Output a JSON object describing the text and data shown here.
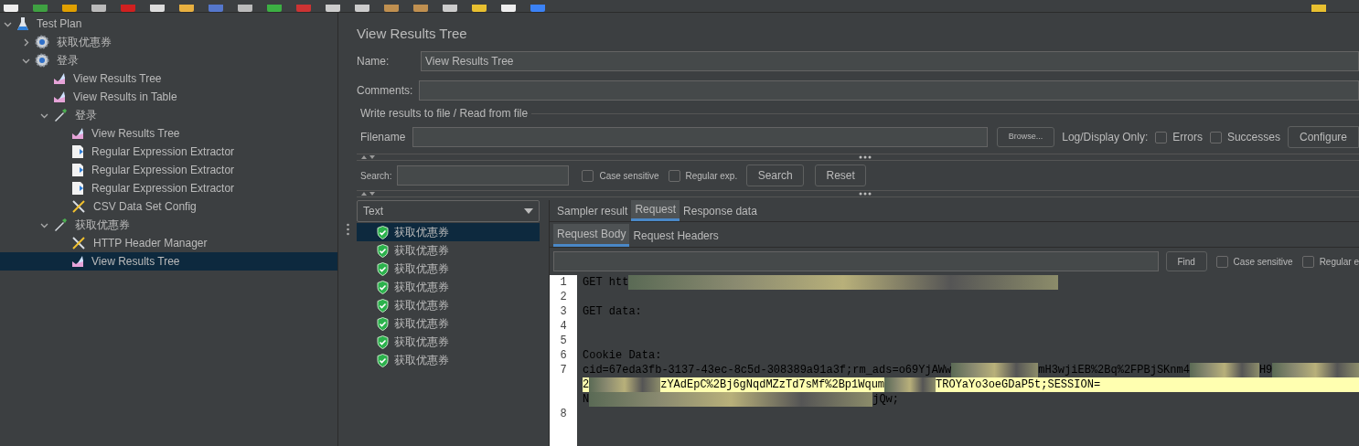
{
  "tree": [
    {
      "label": "Test Plan",
      "kind": "plan",
      "expanded": true,
      "selected": false,
      "children": [
        {
          "label": "获取优惠券",
          "kind": "threadgroup",
          "expanded": false,
          "selected": false
        },
        {
          "label": "登录",
          "kind": "threadgroup",
          "expanded": true,
          "selected": false,
          "children": [
            {
              "label": "View Results Tree",
              "kind": "listener",
              "selected": false
            },
            {
              "label": "View Results in Table",
              "kind": "listener",
              "selected": false
            },
            {
              "label": "登录",
              "kind": "sampler",
              "expanded": true,
              "selected": false,
              "children": [
                {
                  "label": "View Results Tree",
                  "kind": "listener",
                  "selected": false
                },
                {
                  "label": "Regular Expression Extractor",
                  "kind": "extractor",
                  "selected": false
                },
                {
                  "label": "Regular Expression Extractor",
                  "kind": "extractor",
                  "selected": false
                },
                {
                  "label": "Regular Expression Extractor",
                  "kind": "extractor",
                  "selected": false
                },
                {
                  "label": "CSV Data Set Config",
                  "kind": "config",
                  "selected": false
                }
              ]
            },
            {
              "label": "获取优惠券",
              "kind": "sampler",
              "expanded": true,
              "selected": false,
              "children": [
                {
                  "label": "HTTP Header Manager",
                  "kind": "config",
                  "selected": false
                },
                {
                  "label": "View Results Tree",
                  "kind": "listener",
                  "selected": true
                }
              ]
            }
          ]
        }
      ]
    }
  ],
  "panel": {
    "title": "View Results Tree",
    "name_label": "Name:",
    "name_value": "View Results Tree",
    "comments_label": "Comments:",
    "file_group": "Write results to file / Read from file",
    "filename_label": "Filename",
    "browse": "Browse...",
    "log_label": "Log/Display Only:",
    "log_options": [
      {
        "label": "Errors",
        "checked": false
      },
      {
        "label": "Successes",
        "checked": false
      }
    ],
    "configure": "Configure",
    "search_label": "Search:",
    "search_options": [
      {
        "label": "Case sensitive",
        "checked": false
      },
      {
        "label": "Regular exp.",
        "checked": false
      }
    ],
    "search_button": "Search",
    "reset_button": "Reset"
  },
  "renderer": "Text",
  "results": [
    {
      "label": "获取优惠券",
      "selected": true
    },
    {
      "label": "获取优惠券",
      "selected": false
    },
    {
      "label": "获取优惠券",
      "selected": false
    },
    {
      "label": "获取优惠券",
      "selected": false
    },
    {
      "label": "获取优惠券",
      "selected": false
    },
    {
      "label": "获取优惠券",
      "selected": false
    },
    {
      "label": "获取优惠券",
      "selected": false
    },
    {
      "label": "获取优惠券",
      "selected": false
    }
  ],
  "tabs": [
    {
      "label": "Sampler result",
      "selected": false
    },
    {
      "label": "Request",
      "selected": true
    },
    {
      "label": "Response data",
      "selected": false
    }
  ],
  "subtabs": [
    {
      "label": "Request Body",
      "selected": true
    },
    {
      "label": "Request Headers",
      "selected": false
    }
  ],
  "find": {
    "button": "Find",
    "options": [
      {
        "label": "Case sensitive",
        "checked": false
      },
      {
        "label": "Regular e",
        "checked": false
      }
    ]
  },
  "code": [
    {
      "number": "1",
      "rows": [
        [
          {
            "kind": "text",
            "text": "GET htt"
          },
          {
            "kind": "redacted"
          }
        ]
      ]
    },
    {
      "number": "2",
      "rows": [
        []
      ]
    },
    {
      "number": "3",
      "rows": [
        [
          {
            "kind": "text",
            "text": "GET data:"
          }
        ]
      ]
    },
    {
      "number": "4",
      "rows": [
        []
      ]
    },
    {
      "number": "5",
      "rows": [
        []
      ]
    },
    {
      "number": "6",
      "rows": [
        [
          {
            "kind": "text",
            "text": "Cookie Data:"
          }
        ]
      ]
    },
    {
      "number": "7",
      "rows": [
        [
          {
            "kind": "text",
            "text": "cid=67eda3fb-3137-43ec-8c5d-308389a91a3f;rm_ads=o69YjAWw"
          },
          {
            "kind": "redacted"
          },
          {
            "kind": "text",
            "text": "mH3wjiEB%2Bq%2FPBjSKnm4"
          },
          {
            "kind": "redacted"
          },
          {
            "kind": "text",
            "text": "H9"
          },
          {
            "kind": "redacted"
          }
        ],
        [
          {
            "kind": "text",
            "text": "2"
          },
          {
            "kind": "redacted"
          },
          {
            "kind": "text",
            "text": "zYAdEpC%2Bj6gNqdMZzTd7sMf%2Bp1Wqum"
          },
          {
            "kind": "redacted"
          },
          {
            "kind": "text",
            "text": "TROYaYo3oeGDaP5t;SESSION="
          }
        ],
        [
          {
            "kind": "text",
            "text": "N"
          },
          {
            "kind": "redacted"
          },
          {
            "kind": "text",
            "text": "jQw;"
          }
        ]
      ]
    },
    {
      "number": "8",
      "rows": [
        []
      ]
    }
  ]
}
